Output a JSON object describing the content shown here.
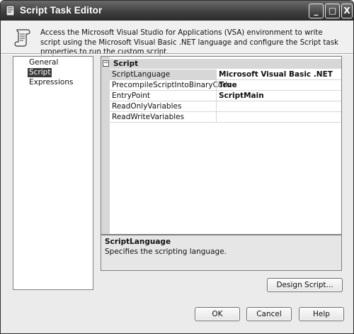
{
  "window": {
    "title": "Script Task Editor",
    "icon": "script-task-icon",
    "caption_buttons": {
      "minimize": "_",
      "maximize": "□",
      "close": "X"
    }
  },
  "header": {
    "icon": "scroll-icon",
    "description": "Access the Microsoft Visual Studio for Applications (VSA) environment to write script using the Microsoft Visual Basic .NET language and configure the Script task properties to run the custom script."
  },
  "nav": {
    "items": [
      {
        "label": "General",
        "selected": false
      },
      {
        "label": "Script",
        "selected": true
      },
      {
        "label": "Expressions",
        "selected": false
      }
    ]
  },
  "properties": {
    "category": {
      "label": "Script",
      "toggle": "⊟"
    },
    "rows": [
      {
        "name": "ScriptLanguage",
        "value": "Microsoft Visual Basic .NET",
        "selected": true
      },
      {
        "name": "PrecompileScriptIntoBinaryCode",
        "value": "True",
        "selected": false
      },
      {
        "name": "EntryPoint",
        "value": "ScriptMain",
        "selected": false
      },
      {
        "name": "ReadOnlyVariables",
        "value": "",
        "selected": false
      },
      {
        "name": "ReadWriteVariables",
        "value": "",
        "selected": false
      }
    ]
  },
  "description_panel": {
    "title": "ScriptLanguage",
    "text": "Specifies the scripting language."
  },
  "buttons": {
    "design_script": "Design Script...",
    "ok": "OK",
    "cancel": "Cancel",
    "help": "Help"
  }
}
